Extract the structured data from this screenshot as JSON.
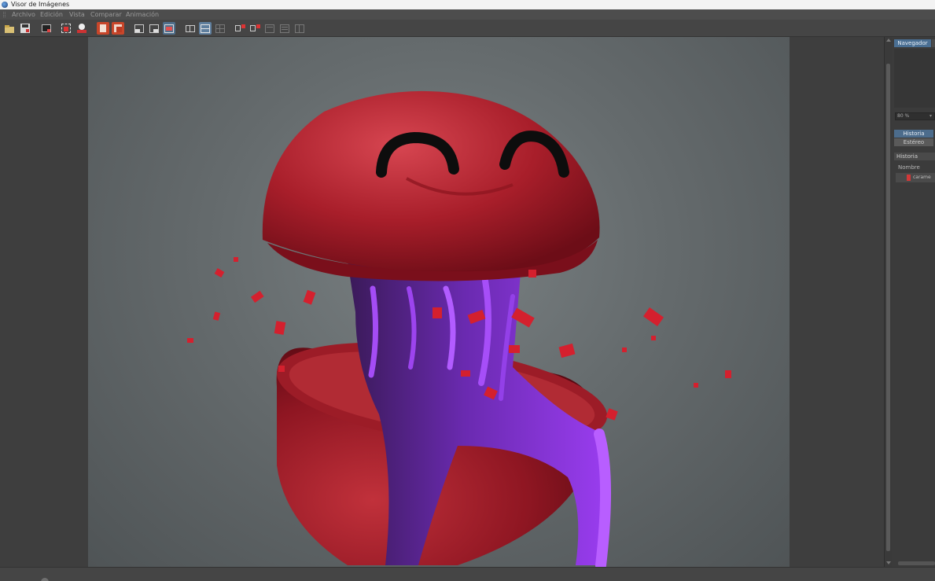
{
  "window": {
    "title": "Visor de Imágenes"
  },
  "menu": [
    {
      "label": "Archivo"
    },
    {
      "label": "Edición"
    },
    {
      "label": "Vista"
    },
    {
      "label": "Comparar"
    },
    {
      "label": "Animación"
    }
  ],
  "toolbar": {
    "icons": [
      "open-folder-icon",
      "save-icon",
      "snapshot-icon",
      "render-region-icon",
      "render-icon",
      "compare-icon",
      "stop-icon",
      "view-a-icon",
      "view-b-icon",
      "view-ab-icon",
      "split-h-icon",
      "split-v-icon",
      "split-grid-icon",
      "channel-a-icon",
      "channel-b-icon",
      "layout-1-icon",
      "layout-2-icon",
      "layout-3-icon"
    ]
  },
  "right_panel": {
    "tab_navigator": "Navegador",
    "zoom_value": "80 %",
    "segment_history": "Historia",
    "segment_stereo": "Estéreo",
    "section_title": "Historia",
    "column_name": "Nombre",
    "history_item": "carame"
  },
  "colors": {
    "accent": "#4a6f93",
    "object_red": "#b5222c",
    "goo_purple": "#7b22c9"
  }
}
